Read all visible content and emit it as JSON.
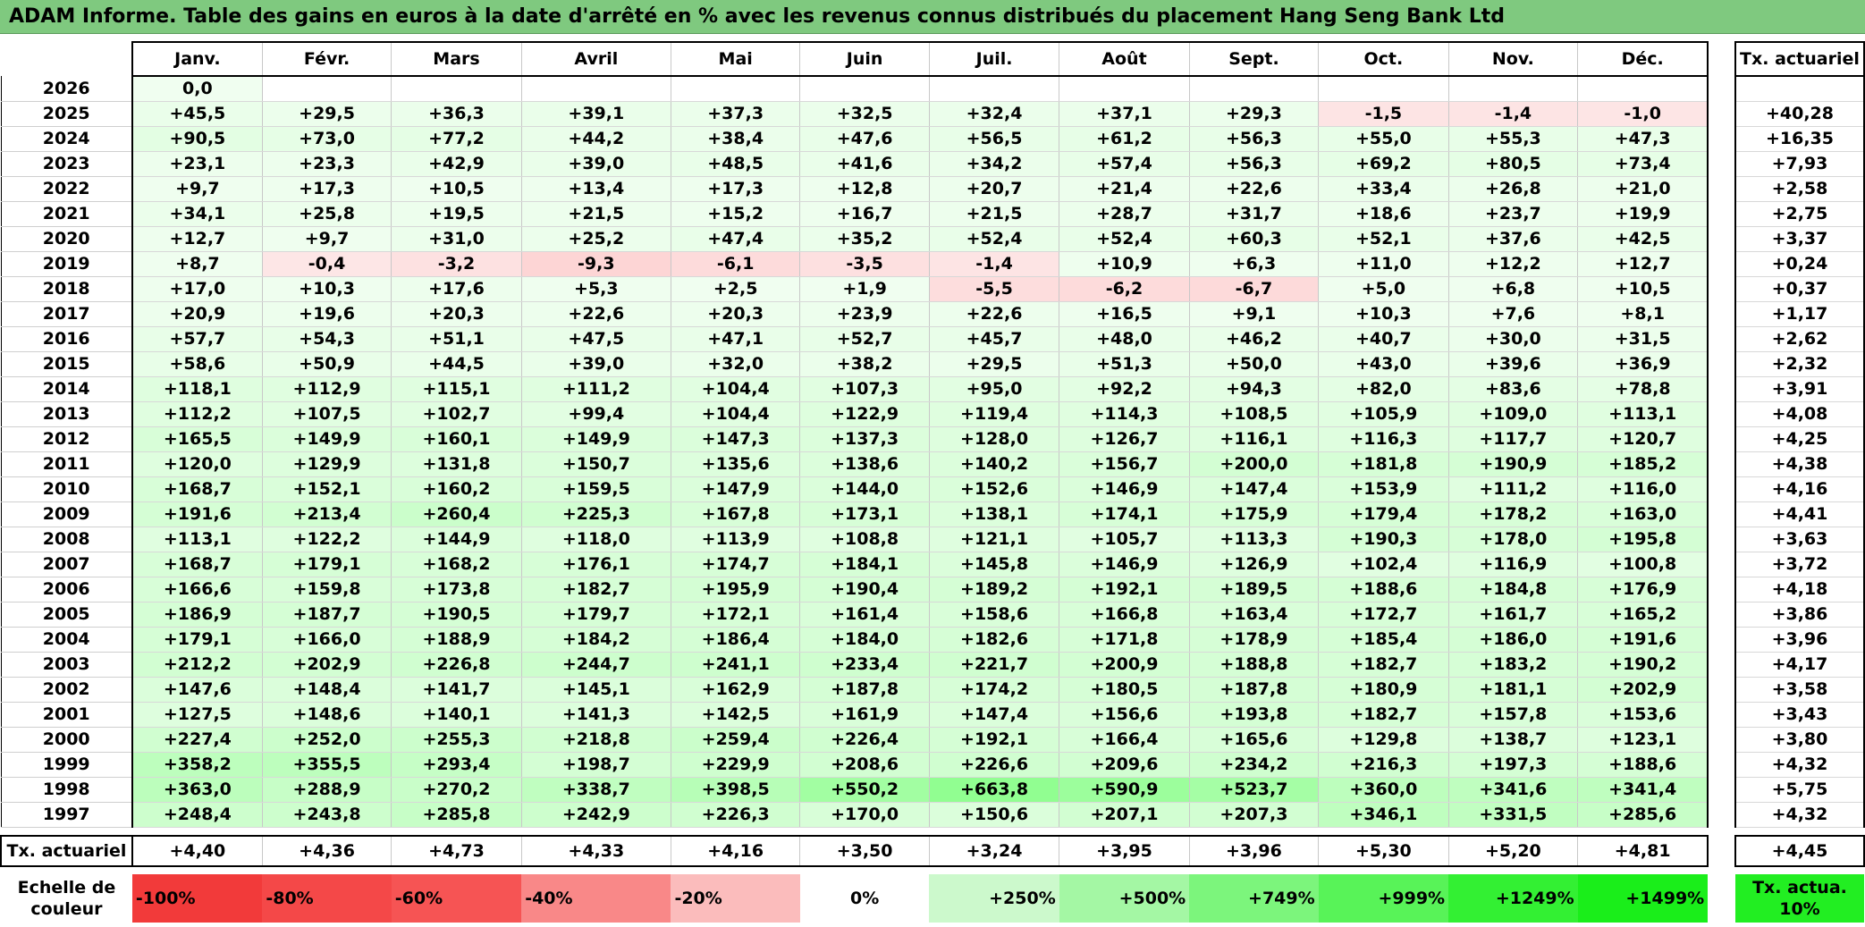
{
  "title": "ADAM Informe. Table des gains en euros à la date d'arrêté en % avec les revenus connus distribués du placement Hang Seng Bank Ltd",
  "months": [
    "Janv.",
    "Févr.",
    "Mars",
    "Avril",
    "Mai",
    "Juin",
    "Juil.",
    "Août",
    "Sept.",
    "Oct.",
    "Nov.",
    "Déc."
  ],
  "rate_header": "Tx. actuariel",
  "rows": [
    {
      "year": "2026",
      "values": [
        "0,0",
        "",
        "",
        "",
        "",
        "",
        "",
        "",
        "",
        "",
        "",
        ""
      ],
      "rate": ""
    },
    {
      "year": "2025",
      "values": [
        "+45,5",
        "+29,5",
        "+36,3",
        "+39,1",
        "+37,3",
        "+32,5",
        "+32,4",
        "+37,1",
        "+29,3",
        "-1,5",
        "-1,4",
        "-1,0"
      ],
      "rate": "+40,28"
    },
    {
      "year": "2024",
      "values": [
        "+90,5",
        "+73,0",
        "+77,2",
        "+44,2",
        "+38,4",
        "+47,6",
        "+56,5",
        "+61,2",
        "+56,3",
        "+55,0",
        "+55,3",
        "+47,3"
      ],
      "rate": "+16,35"
    },
    {
      "year": "2023",
      "values": [
        "+23,1",
        "+23,3",
        "+42,9",
        "+39,0",
        "+48,5",
        "+41,6",
        "+34,2",
        "+57,4",
        "+56,3",
        "+69,2",
        "+80,5",
        "+73,4"
      ],
      "rate": "+7,93"
    },
    {
      "year": "2022",
      "values": [
        "+9,7",
        "+17,3",
        "+10,5",
        "+13,4",
        "+17,3",
        "+12,8",
        "+20,7",
        "+21,4",
        "+22,6",
        "+33,4",
        "+26,8",
        "+21,0"
      ],
      "rate": "+2,58"
    },
    {
      "year": "2021",
      "values": [
        "+34,1",
        "+25,8",
        "+19,5",
        "+21,5",
        "+15,2",
        "+16,7",
        "+21,5",
        "+28,7",
        "+31,7",
        "+18,6",
        "+23,7",
        "+19,9"
      ],
      "rate": "+2,75"
    },
    {
      "year": "2020",
      "values": [
        "+12,7",
        "+9,7",
        "+31,0",
        "+25,2",
        "+47,4",
        "+35,2",
        "+52,4",
        "+52,4",
        "+60,3",
        "+52,1",
        "+37,6",
        "+42,5"
      ],
      "rate": "+3,37"
    },
    {
      "year": "2019",
      "values": [
        "+8,7",
        "-0,4",
        "-3,2",
        "-9,3",
        "-6,1",
        "-3,5",
        "-1,4",
        "+10,9",
        "+6,3",
        "+11,0",
        "+12,2",
        "+12,7"
      ],
      "rate": "+0,24"
    },
    {
      "year": "2018",
      "values": [
        "+17,0",
        "+10,3",
        "+17,6",
        "+5,3",
        "+2,5",
        "+1,9",
        "-5,5",
        "-6,2",
        "-6,7",
        "+5,0",
        "+6,8",
        "+10,5"
      ],
      "rate": "+0,37"
    },
    {
      "year": "2017",
      "values": [
        "+20,9",
        "+19,6",
        "+20,3",
        "+22,6",
        "+20,3",
        "+23,9",
        "+22,6",
        "+16,5",
        "+9,1",
        "+10,3",
        "+7,6",
        "+8,1"
      ],
      "rate": "+1,17"
    },
    {
      "year": "2016",
      "values": [
        "+57,7",
        "+54,3",
        "+51,1",
        "+47,5",
        "+47,1",
        "+52,7",
        "+45,7",
        "+48,0",
        "+46,2",
        "+40,7",
        "+30,0",
        "+31,5"
      ],
      "rate": "+2,62"
    },
    {
      "year": "2015",
      "values": [
        "+58,6",
        "+50,9",
        "+44,5",
        "+39,0",
        "+32,0",
        "+38,2",
        "+29,5",
        "+51,3",
        "+50,0",
        "+43,0",
        "+39,6",
        "+36,9"
      ],
      "rate": "+2,32"
    },
    {
      "year": "2014",
      "values": [
        "+118,1",
        "+112,9",
        "+115,1",
        "+111,2",
        "+104,4",
        "+107,3",
        "+95,0",
        "+92,2",
        "+94,3",
        "+82,0",
        "+83,6",
        "+78,8"
      ],
      "rate": "+3,91"
    },
    {
      "year": "2013",
      "values": [
        "+112,2",
        "+107,5",
        "+102,7",
        "+99,4",
        "+104,4",
        "+122,9",
        "+119,4",
        "+114,3",
        "+108,5",
        "+105,9",
        "+109,0",
        "+113,1"
      ],
      "rate": "+4,08"
    },
    {
      "year": "2012",
      "values": [
        "+165,5",
        "+149,9",
        "+160,1",
        "+149,9",
        "+147,3",
        "+137,3",
        "+128,0",
        "+126,7",
        "+116,1",
        "+116,3",
        "+117,7",
        "+120,7"
      ],
      "rate": "+4,25"
    },
    {
      "year": "2011",
      "values": [
        "+120,0",
        "+129,9",
        "+131,8",
        "+150,7",
        "+135,6",
        "+138,6",
        "+140,2",
        "+156,7",
        "+200,0",
        "+181,8",
        "+190,9",
        "+185,2"
      ],
      "rate": "+4,38"
    },
    {
      "year": "2010",
      "values": [
        "+168,7",
        "+152,1",
        "+160,2",
        "+159,5",
        "+147,9",
        "+144,0",
        "+152,6",
        "+146,9",
        "+147,4",
        "+153,9",
        "+111,2",
        "+116,0"
      ],
      "rate": "+4,16"
    },
    {
      "year": "2009",
      "values": [
        "+191,6",
        "+213,4",
        "+260,4",
        "+225,3",
        "+167,8",
        "+173,1",
        "+138,1",
        "+174,1",
        "+175,9",
        "+179,4",
        "+178,2",
        "+163,0"
      ],
      "rate": "+4,41"
    },
    {
      "year": "2008",
      "values": [
        "+113,1",
        "+122,2",
        "+144,9",
        "+118,0",
        "+113,9",
        "+108,8",
        "+121,1",
        "+105,7",
        "+113,3",
        "+190,3",
        "+178,0",
        "+195,8"
      ],
      "rate": "+3,63"
    },
    {
      "year": "2007",
      "values": [
        "+168,7",
        "+179,1",
        "+168,2",
        "+176,1",
        "+174,7",
        "+184,1",
        "+145,8",
        "+146,9",
        "+126,9",
        "+102,4",
        "+116,9",
        "+100,8"
      ],
      "rate": "+3,72"
    },
    {
      "year": "2006",
      "values": [
        "+166,6",
        "+159,8",
        "+173,8",
        "+182,7",
        "+195,9",
        "+190,4",
        "+189,2",
        "+192,1",
        "+189,5",
        "+188,6",
        "+184,8",
        "+176,9"
      ],
      "rate": "+4,18"
    },
    {
      "year": "2005",
      "values": [
        "+186,9",
        "+187,7",
        "+190,5",
        "+179,7",
        "+172,1",
        "+161,4",
        "+158,6",
        "+166,8",
        "+163,4",
        "+172,7",
        "+161,7",
        "+165,2"
      ],
      "rate": "+3,86"
    },
    {
      "year": "2004",
      "values": [
        "+179,1",
        "+166,0",
        "+188,9",
        "+184,2",
        "+186,4",
        "+184,0",
        "+182,6",
        "+171,8",
        "+178,9",
        "+185,4",
        "+186,0",
        "+191,6"
      ],
      "rate": "+3,96"
    },
    {
      "year": "2003",
      "values": [
        "+212,2",
        "+202,9",
        "+226,8",
        "+244,7",
        "+241,1",
        "+233,4",
        "+221,7",
        "+200,9",
        "+188,8",
        "+182,7",
        "+183,2",
        "+190,2"
      ],
      "rate": "+4,17"
    },
    {
      "year": "2002",
      "values": [
        "+147,6",
        "+148,4",
        "+141,7",
        "+145,1",
        "+162,9",
        "+187,8",
        "+174,2",
        "+180,5",
        "+187,8",
        "+180,9",
        "+181,1",
        "+202,9"
      ],
      "rate": "+3,58"
    },
    {
      "year": "2001",
      "values": [
        "+127,5",
        "+148,6",
        "+140,1",
        "+141,3",
        "+142,5",
        "+161,9",
        "+147,4",
        "+156,6",
        "+193,8",
        "+182,7",
        "+157,8",
        "+153,6"
      ],
      "rate": "+3,43"
    },
    {
      "year": "2000",
      "values": [
        "+227,4",
        "+252,0",
        "+255,3",
        "+218,8",
        "+259,4",
        "+226,4",
        "+192,1",
        "+166,4",
        "+165,6",
        "+129,8",
        "+138,7",
        "+123,1"
      ],
      "rate": "+3,80"
    },
    {
      "year": "1999",
      "values": [
        "+358,2",
        "+355,5",
        "+293,4",
        "+198,7",
        "+229,9",
        "+208,6",
        "+226,6",
        "+209,6",
        "+234,2",
        "+216,3",
        "+197,3",
        "+188,6"
      ],
      "rate": "+4,32"
    },
    {
      "year": "1998",
      "values": [
        "+363,0",
        "+288,9",
        "+270,2",
        "+338,7",
        "+398,5",
        "+550,2",
        "+663,8",
        "+590,9",
        "+523,7",
        "+360,0",
        "+341,6",
        "+341,4"
      ],
      "rate": "+5,75"
    },
    {
      "year": "1997",
      "values": [
        "+248,4",
        "+243,8",
        "+285,8",
        "+242,9",
        "+226,3",
        "+170,0",
        "+150,6",
        "+207,1",
        "+207,3",
        "+346,1",
        "+331,5",
        "+285,6"
      ],
      "rate": "+4,32"
    }
  ],
  "actuarial": {
    "label": "Tx. actuariel",
    "values": [
      "+4,40",
      "+4,36",
      "+4,73",
      "+4,33",
      "+4,16",
      "+3,50",
      "+3,24",
      "+3,95",
      "+3,96",
      "+5,30",
      "+5,20",
      "+4,81"
    ],
    "rate": "+4,45"
  },
  "scale": {
    "label": "Echelle de couleur",
    "items": [
      {
        "text": "-100%",
        "color": "#f23a3a"
      },
      {
        "text": "-80%",
        "color": "#f44848"
      },
      {
        "text": "-60%",
        "color": "#f65454"
      },
      {
        "text": "-40%",
        "color": "#f98888"
      },
      {
        "text": "-20%",
        "color": "#fbbcbc"
      },
      {
        "text": "0%",
        "color": "#ffffff"
      },
      {
        "text": "+250%",
        "color": "#ccf9cc"
      },
      {
        "text": "+500%",
        "color": "#a4f7a4"
      },
      {
        "text": "+749%",
        "color": "#7cf57c"
      },
      {
        "text": "+999%",
        "color": "#58f358"
      },
      {
        "text": "+1249%",
        "color": "#33f033"
      },
      {
        "text": "+1499%",
        "color": "#1aee1a"
      }
    ],
    "rate_label": "Tx. actua. 10%"
  },
  "colors": {
    "title_bar": "#7fc97f",
    "negative_light": "#fde7e7",
    "positive_scale_max": "#1aee1a"
  }
}
